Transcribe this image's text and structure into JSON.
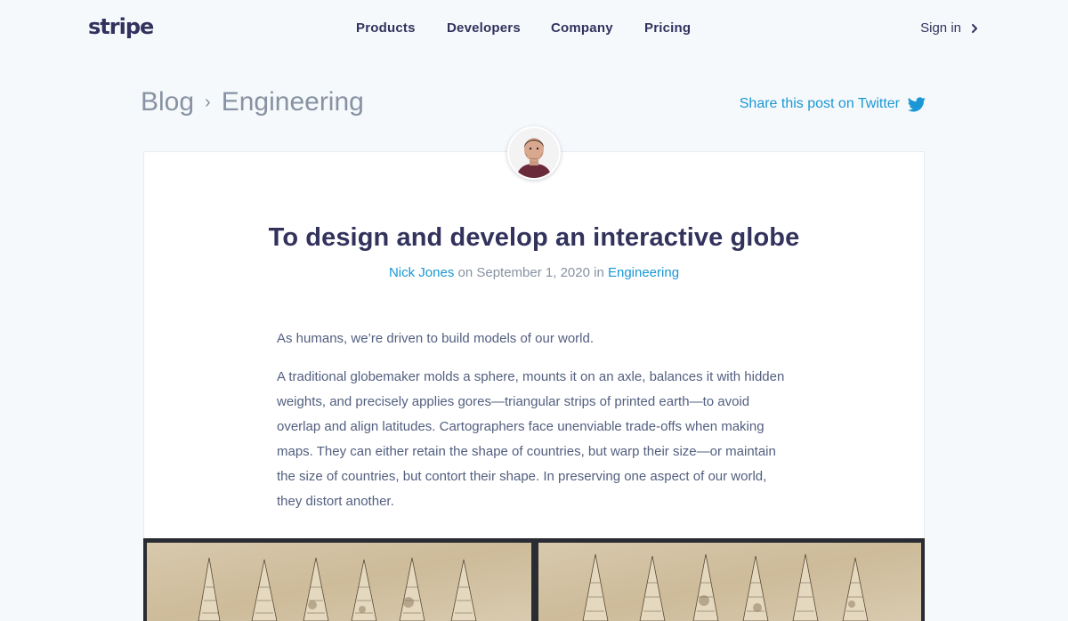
{
  "brand": {
    "logo": "stripe"
  },
  "nav": {
    "items": [
      {
        "label": "Products"
      },
      {
        "label": "Developers"
      },
      {
        "label": "Company"
      },
      {
        "label": "Pricing"
      }
    ],
    "sign_in": "Sign in"
  },
  "breadcrumb": {
    "root": "Blog",
    "separator": "›",
    "current": "Engineering"
  },
  "share": {
    "label": "Share this post on Twitter",
    "icon": "twitter-icon"
  },
  "post": {
    "title": "To design and develop an interactive globe",
    "author": "Nick Jones",
    "on": "on",
    "date": "September 1, 2020",
    "in": "in",
    "category": "Engineering",
    "paragraphs": [
      "As humans, we’re driven to build models of our world.",
      "A traditional globemaker molds a sphere, mounts it on an axle, balances it with hidden weights, and precisely applies gores—triangular strips of printed earth—to avoid overlap and align latitudes. Cartographers face unenviable trade-offs when making maps. They can either retain the shape of countries, but warp their size—or maintain the size of countries, but contort their shape. In preserving one aspect of our world, they distort another."
    ]
  },
  "colors": {
    "background": "#f6f9fc",
    "text_dark": "#32325d",
    "text_body": "#525f7f",
    "text_muted": "#8792a2",
    "link": "#1a97d4"
  }
}
